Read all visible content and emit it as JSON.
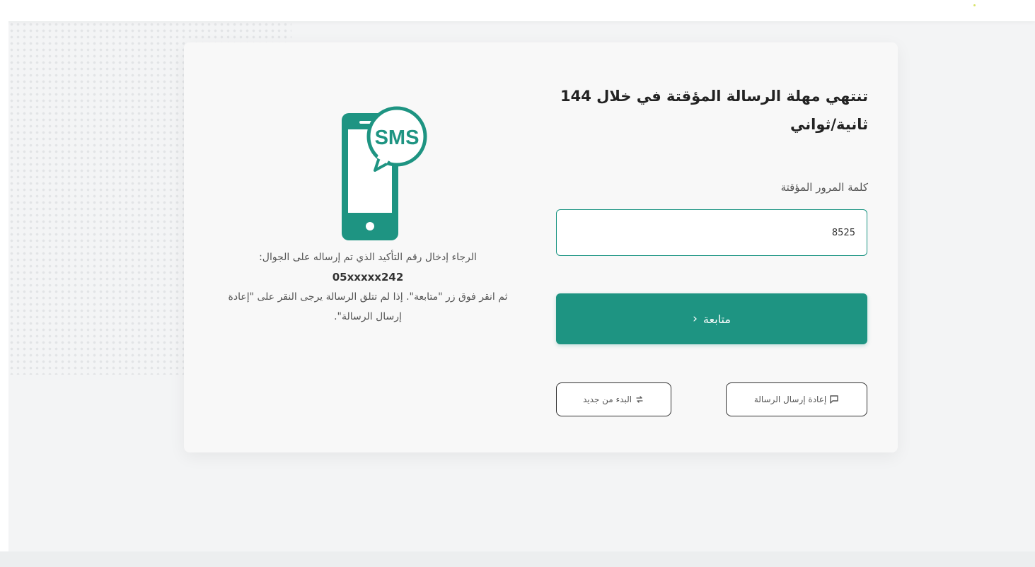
{
  "colors": {
    "accent": "#1e9482",
    "background": "#f3f4f5",
    "card": "#f8f8f8"
  },
  "otp": {
    "title": "تنتهي مهلة الرسالة المؤقتة في خلال 144 ثانية/ثواني",
    "field_label": "كلمة المرور المؤقتة",
    "value": "8525",
    "continue_label": "متابعة",
    "continue_icon": "chevron-left-icon",
    "resend_label": "إعادة إرسال الرسالة",
    "resend_icon": "message-icon",
    "restart_label": "البدء من جديد",
    "restart_icon": "refresh-icon"
  },
  "illustration": {
    "icon": "sms-phone-icon",
    "text": "SMS"
  },
  "instructions": {
    "line1": "الرجاء إدخال رقم التأكيد الذي تم إرساله على الجوال:",
    "phone": "05xxxxx242",
    "line2": "ثم انقر فوق زر \"متابعة\". إذا لم تتلق الرسالة يرجى النقر على \"إعادة إرسال الرسالة\"."
  }
}
